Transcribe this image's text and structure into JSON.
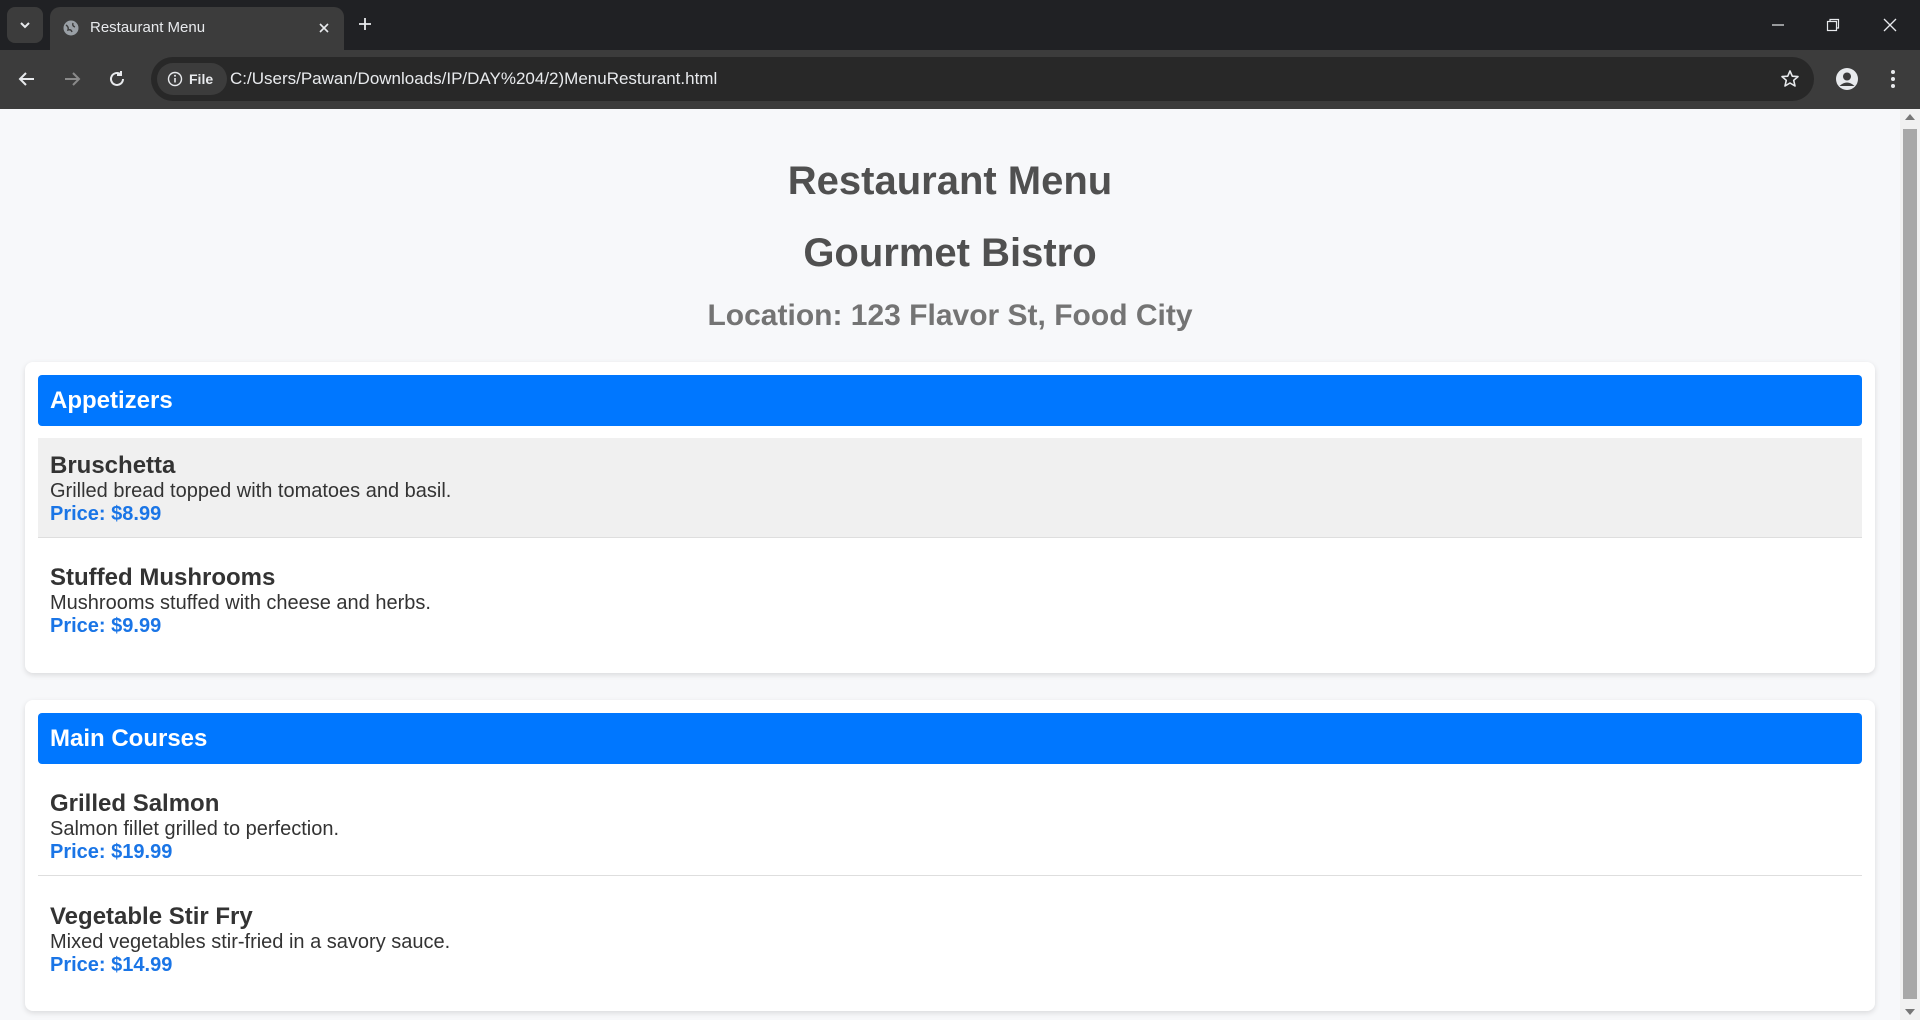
{
  "browser": {
    "tab_title": "Restaurant Menu",
    "site_chip_label": "File",
    "url": "C:/Users/Pawan/Downloads/IP/DAY%204/2)MenuResturant.html"
  },
  "page": {
    "title": "Restaurant Menu",
    "restaurant_name": "Gourmet Bistro",
    "location": "Location: 123 Flavor St, Food City"
  },
  "sections": [
    {
      "title": "Appetizers",
      "items": [
        {
          "name": "Bruschetta",
          "description": "Grilled bread topped with tomatoes and basil.",
          "price": "Price: $8.99"
        },
        {
          "name": "Stuffed Mushrooms",
          "description": "Mushrooms stuffed with cheese and herbs.",
          "price": "Price: $9.99"
        }
      ]
    },
    {
      "title": "Main Courses",
      "items": [
        {
          "name": "Grilled Salmon",
          "description": "Salmon fillet grilled to perfection.",
          "price": "Price: $19.99"
        },
        {
          "name": "Vegetable Stir Fry",
          "description": "Mixed vegetables stir-fried in a savory sauce.",
          "price": "Price: $14.99"
        }
      ]
    }
  ],
  "colors": {
    "accent": "#0077ff",
    "price": "#1a75e6",
    "page_bg": "#f7f8fa",
    "browser_frame": "#202124"
  }
}
